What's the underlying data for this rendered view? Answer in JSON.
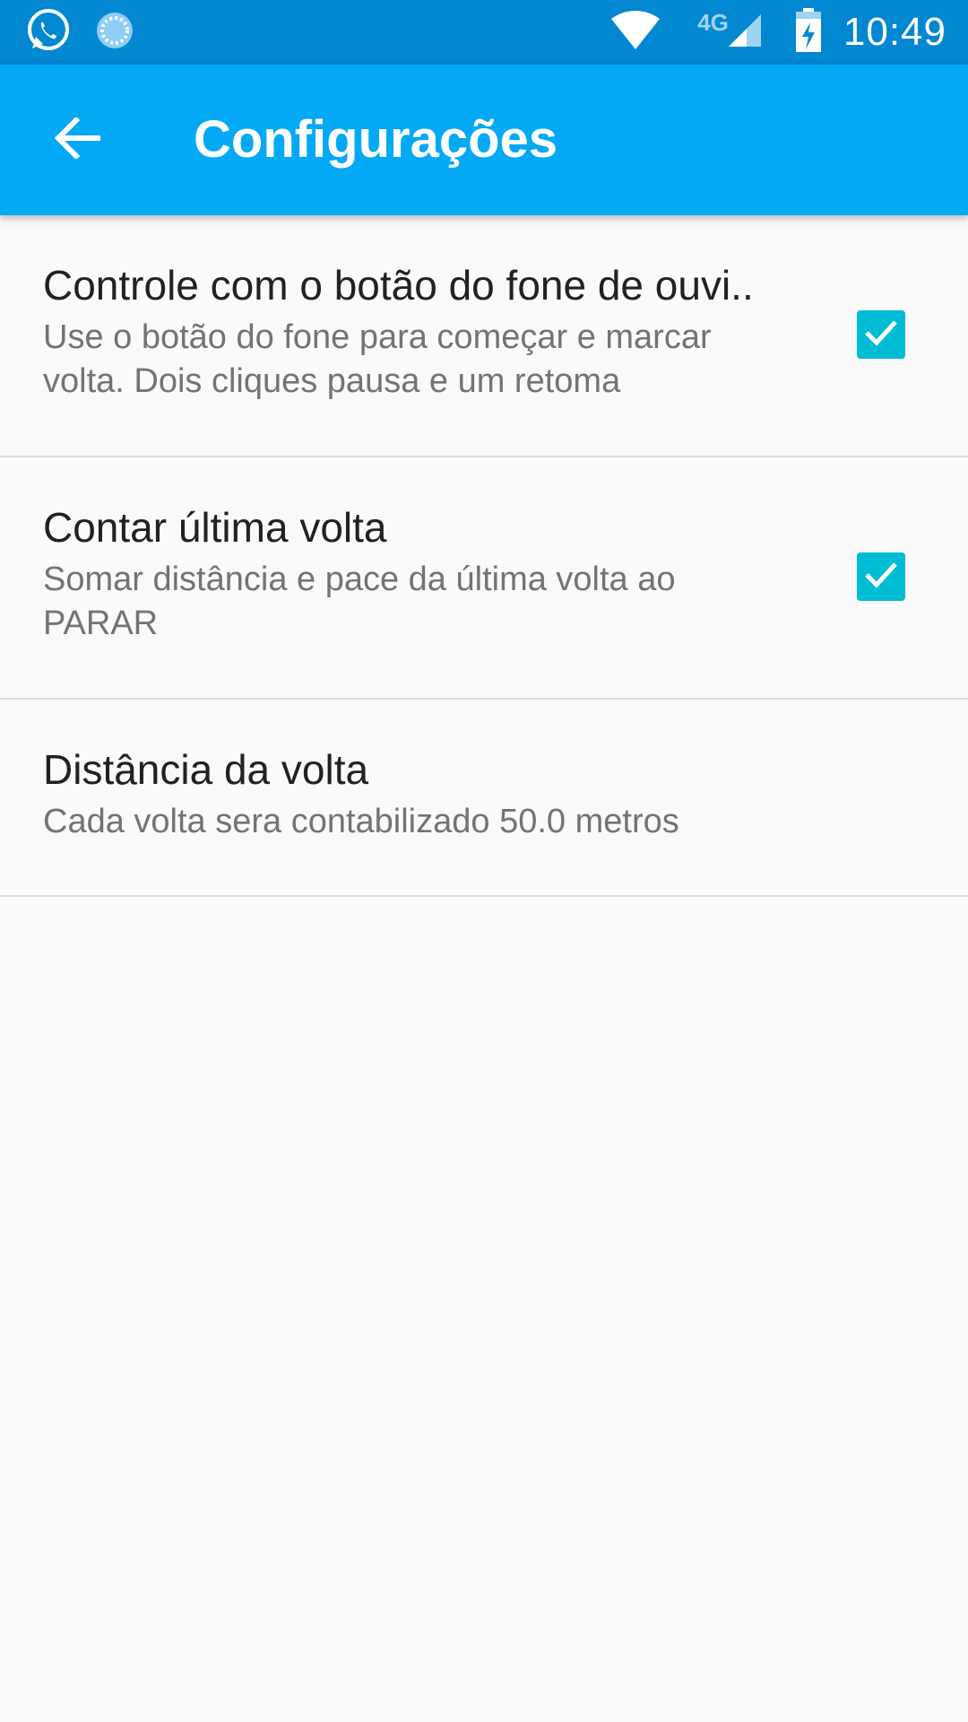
{
  "status_bar": {
    "time": "10:49",
    "network_label": "4G",
    "icons": [
      "whatsapp-icon",
      "sync-spinner-icon",
      "wifi-icon",
      "cell-signal-icon",
      "battery-charging-icon"
    ]
  },
  "app_bar": {
    "title": "Configurações",
    "back_icon": "arrow-back-icon",
    "background_color": "#03A9F4",
    "status_color": "#0288D1"
  },
  "preferences": [
    {
      "title": "Controle com o botão do fone de ouvi..",
      "summary": "Use o botão do fone para começar e marcar volta. Dois cliques pausa e um retoma",
      "checkbox": true
    },
    {
      "title": "Contar última volta",
      "summary": "Somar distância e pace da última volta ao PARAR",
      "checkbox": true
    },
    {
      "title": "Distância da volta",
      "summary": "Cada volta sera contabilizado 50.0 metros",
      "checkbox": null
    }
  ],
  "colors": {
    "checkbox_accent": "#00BCD4",
    "background": "#FAFAFA"
  }
}
